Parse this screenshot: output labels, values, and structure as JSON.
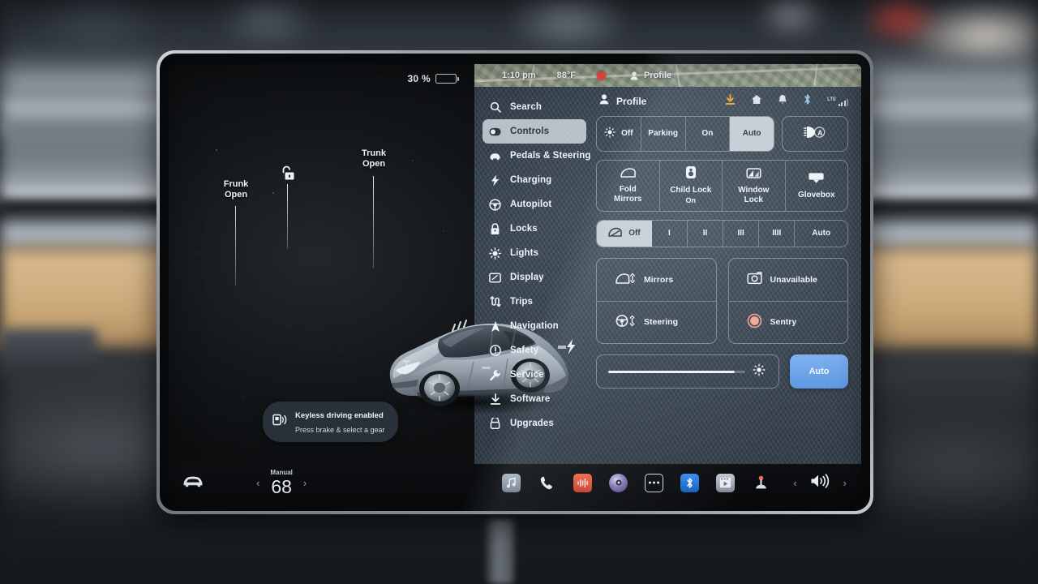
{
  "device": {
    "name": "tesla-model-3-center-touchscreen"
  },
  "status_bar": {
    "battery_percent": "30 %",
    "battery_level": 30,
    "time": "1:10 pm",
    "temperature": "88°F",
    "profile_label": "Profile",
    "icons": [
      "download-icon",
      "home-icon",
      "bell-icon",
      "bluetooth-icon",
      "lte-signal-icon"
    ],
    "lte_label": "LTE"
  },
  "car_view": {
    "frunk_label": "Frunk\nOpen",
    "frunk_line1": "Frunk",
    "frunk_line2": "Open",
    "trunk_line1": "Trunk",
    "trunk_line2": "Open",
    "lock_icon": "unlock-icon",
    "toast": {
      "icon": "keyfob-icon",
      "title": "Keyless driving enabled",
      "subtitle": "Press brake & select a gear"
    }
  },
  "sidebar": {
    "items": [
      {
        "label": "Search",
        "icon": "search-icon",
        "selected": false
      },
      {
        "label": "Controls",
        "icon": "toggle-icon",
        "selected": true
      },
      {
        "label": "Pedals & Steering",
        "icon": "car-icon",
        "selected": false
      },
      {
        "label": "Charging",
        "icon": "bolt-icon",
        "selected": false
      },
      {
        "label": "Autopilot",
        "icon": "steering-icon",
        "selected": false
      },
      {
        "label": "Locks",
        "icon": "lock-icon",
        "selected": false
      },
      {
        "label": "Lights",
        "icon": "sun-icon",
        "selected": false
      },
      {
        "label": "Display",
        "icon": "display-icon",
        "selected": false
      },
      {
        "label": "Trips",
        "icon": "trips-icon",
        "selected": false
      },
      {
        "label": "Navigation",
        "icon": "navigation-icon",
        "selected": false
      },
      {
        "label": "Safety",
        "icon": "safety-icon",
        "selected": false
      },
      {
        "label": "Service",
        "icon": "wrench-icon",
        "selected": false
      },
      {
        "label": "Software",
        "icon": "download-icon",
        "selected": false
      },
      {
        "label": "Upgrades",
        "icon": "upgrades-icon",
        "selected": false
      }
    ]
  },
  "controls": {
    "headlights": {
      "options": [
        {
          "label": "Off",
          "icon": "headlight-off-icon",
          "selected": false
        },
        {
          "label": "Parking",
          "icon": null,
          "selected": false
        },
        {
          "label": "On",
          "icon": null,
          "selected": false
        },
        {
          "label": "Auto",
          "icon": null,
          "selected": true
        }
      ],
      "high_beam_icon": "auto-high-beam-icon"
    },
    "quick_row": [
      {
        "label": "Fold",
        "sub": "Mirrors",
        "icon": "mirror-icon",
        "selected": false
      },
      {
        "label": "Child Lock",
        "sub": "On",
        "icon": "child-lock-icon",
        "selected": false
      },
      {
        "label": "Window",
        "sub": "Lock",
        "icon": "window-lock-icon",
        "selected": false
      },
      {
        "label": "Glovebox",
        "sub": "",
        "icon": "glovebox-icon",
        "selected": false
      }
    ],
    "wipers": {
      "options": [
        {
          "label": "Off",
          "icon": "wiper-icon",
          "selected": true
        },
        {
          "label": "I",
          "icon": null,
          "selected": false
        },
        {
          "label": "II",
          "icon": null,
          "selected": false
        },
        {
          "label": "III",
          "icon": null,
          "selected": false
        },
        {
          "label": "IIII",
          "icon": null,
          "selected": false
        },
        {
          "label": "Auto",
          "icon": null,
          "selected": false
        }
      ]
    },
    "adjust_left": [
      {
        "label": "Mirrors",
        "icon": "mirror-adjust-icon"
      },
      {
        "label": "Steering",
        "icon": "steering-adjust-icon"
      }
    ],
    "adjust_right": [
      {
        "label": "Unavailable",
        "icon": "dashcam-icon",
        "accent": "#eff4f8"
      },
      {
        "label": "Sentry",
        "icon": "sentry-icon",
        "accent": "#ef9a90"
      }
    ],
    "brightness": {
      "value": 92,
      "icon": "brightness-icon",
      "auto_label": "Auto",
      "auto_active": true,
      "auto_color": "#5f99e4"
    }
  },
  "taskbar": {
    "car_icon": "car-front-icon",
    "climate": {
      "mode": "Manual",
      "temperature": "68",
      "decrease_icon": "chevron-left-icon",
      "increase_icon": "chevron-right-icon"
    },
    "apps": [
      {
        "name": "media-icon",
        "color": "#9aa8b6"
      },
      {
        "name": "phone-icon",
        "color": "#eef3f8"
      },
      {
        "name": "tuner-icon",
        "color": "#e8563c"
      },
      {
        "name": "browser-icon",
        "color": "#6d5fa8"
      },
      {
        "name": "more-icon",
        "color": "#eef3f8"
      },
      {
        "name": "bluetooth-icon",
        "color": "#1e74d8"
      },
      {
        "name": "theater-icon",
        "color": "#aab4be"
      },
      {
        "name": "arcade-icon",
        "color": "#e8564e"
      }
    ],
    "volume": {
      "decrease_icon": "chevron-left-icon",
      "speaker_icon": "volume-icon",
      "increase_icon": "chevron-right-icon"
    }
  }
}
